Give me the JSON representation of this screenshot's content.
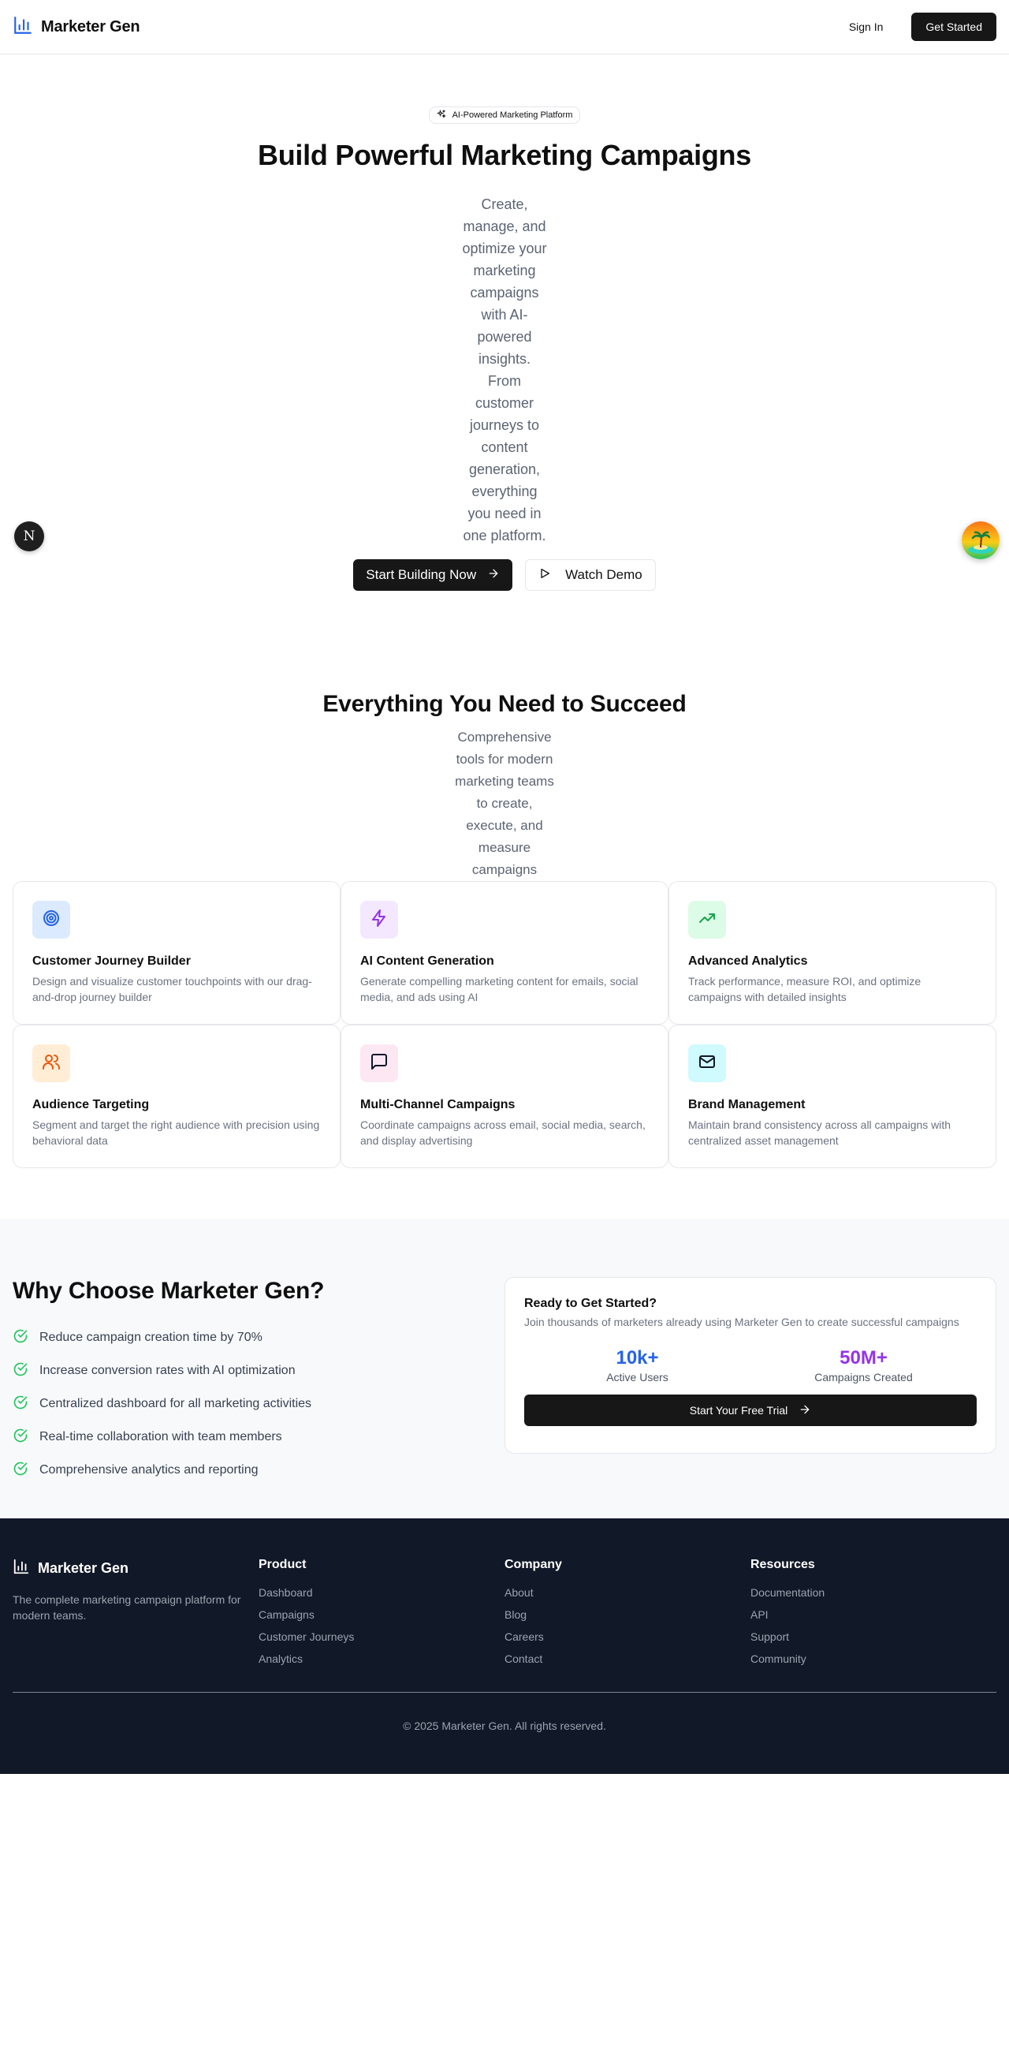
{
  "header": {
    "brand": "Marketer Gen",
    "sign_in": "Sign In",
    "get_started": "Get Started"
  },
  "hero": {
    "badge": "AI-Powered Marketing Platform",
    "title": "Build Powerful Marketing Campaigns",
    "description": "Create, manage, and optimize your marketing campaigns with AI-powered insights. From customer journeys to content generation, everything you need in one platform.",
    "primary_cta": "Start Building Now",
    "secondary_cta": "Watch Demo"
  },
  "features": {
    "title": "Everything You Need to Succeed",
    "subtitle": "Comprehensive tools for modern marketing teams to create, execute, and measure campaigns",
    "cards": [
      {
        "title": "Customer Journey Builder",
        "desc": "Design and visualize customer touchpoints with our drag-and-drop journey builder",
        "icon": "target-icon",
        "bg": "#dbeafe",
        "fg": "#2563eb"
      },
      {
        "title": "AI Content Generation",
        "desc": "Generate compelling marketing content for emails, social media, and ads using AI",
        "icon": "zap-icon",
        "bg": "#f3e8ff",
        "fg": "#9333ea"
      },
      {
        "title": "Advanced Analytics",
        "desc": "Track performance, measure ROI, and optimize campaigns with detailed insights",
        "icon": "trending-up-icon",
        "bg": "#dcfce7",
        "fg": "#16a34a"
      },
      {
        "title": "Audience Targeting",
        "desc": "Segment and target the right audience with precision using behavioral data",
        "icon": "users-icon",
        "bg": "#ffedd5",
        "fg": "#ea580c"
      },
      {
        "title": "Multi-Channel Campaigns",
        "desc": "Coordinate campaigns across email, social media, search, and display advertising",
        "icon": "message-square-icon",
        "bg": "#fce7f3",
        "fg": "#111827"
      },
      {
        "title": "Brand Management",
        "desc": "Maintain brand consistency across all campaigns with centralized asset management",
        "icon": "mail-icon",
        "bg": "#cffafe",
        "fg": "#111827"
      }
    ]
  },
  "why": {
    "title": "Why Choose Marketer Gen?",
    "items": [
      "Reduce campaign creation time by 70%",
      "Increase conversion rates with AI optimization",
      "Centralized dashboard for all marketing activities",
      "Real-time collaboration with team members",
      "Comprehensive analytics and reporting"
    ],
    "cta": {
      "title": "Ready to Get Started?",
      "subtitle": "Join thousands of marketers already using Marketer Gen to create successful campaigns",
      "stats": [
        {
          "value": "10k+",
          "label": "Active Users",
          "color": "#2563eb"
        },
        {
          "value": "50M+",
          "label": "Campaigns Created",
          "color": "#9333ea"
        }
      ],
      "button": "Start Your Free Trial"
    }
  },
  "footer": {
    "brand": "Marketer Gen",
    "tagline": "The complete marketing campaign platform for modern teams.",
    "columns": [
      {
        "heading": "Product",
        "links": [
          "Dashboard",
          "Campaigns",
          "Customer Journeys",
          "Analytics"
        ]
      },
      {
        "heading": "Company",
        "links": [
          "About",
          "Blog",
          "Careers",
          "Contact"
        ]
      },
      {
        "heading": "Resources",
        "links": [
          "Documentation",
          "API",
          "Support",
          "Community"
        ]
      }
    ],
    "copyright": "© 2025 Marketer Gen. All rights reserved."
  },
  "floating": {
    "dev_badge": "N"
  },
  "colors": {
    "accent_blue": "#2563eb",
    "check_green": "#22c55e",
    "footer_bg": "#111827",
    "button_dark": "#171717"
  }
}
